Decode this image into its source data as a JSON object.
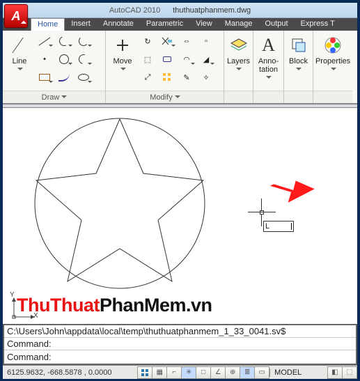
{
  "app": {
    "logo_letter": "A",
    "title1": "AutoCAD 2010",
    "title2": "thuthuatphanmem.dwg"
  },
  "tabs": [
    "Home",
    "Insert",
    "Annotate",
    "Parametric",
    "View",
    "Manage",
    "Output",
    "Express T"
  ],
  "active_tab": 0,
  "ribbon": {
    "draw": {
      "title": "Draw",
      "line_label": "Line",
      "tools": [
        "line-tool",
        "polyline-tool",
        "arc-tool",
        "curve-tool",
        "circle-tool",
        "arc2-tool",
        "rectangle-tool",
        "spline-tool",
        "ellipse-tool"
      ]
    },
    "modify": {
      "title": "Modify",
      "move_label": "Move",
      "tools": [
        "move-tool",
        "rotate-tool",
        "trim-tool",
        "extend-tool",
        "copy-tool",
        "mirror-tool",
        "fillet-tool",
        "offset-tool",
        "stretch-tool",
        "scale-tool",
        "array-tool",
        "explode-tool"
      ]
    },
    "layers": {
      "title": "Layers",
      "label": "Layers"
    },
    "annotation": {
      "title": "",
      "label": "Anno-\ntation",
      "label_line1": "Anno-",
      "label_line2": "tation"
    },
    "block": {
      "title": "",
      "label": "Block"
    },
    "props": {
      "title": "",
      "label": "Properties"
    }
  },
  "dynamic_input": "L",
  "watermark": {
    "red": "ThuThuat",
    "black": "PhanMem.vn"
  },
  "command_history": [
    "C:\\Users\\John\\appdata\\local\\temp\\thuthuatphanmem_1_33_0041.sv$",
    "Command:"
  ],
  "command_prompt": "Command:",
  "command_value": "",
  "status": {
    "coords": "6125.9632, -668.5878 , 0.0000",
    "mode": "MODEL"
  }
}
